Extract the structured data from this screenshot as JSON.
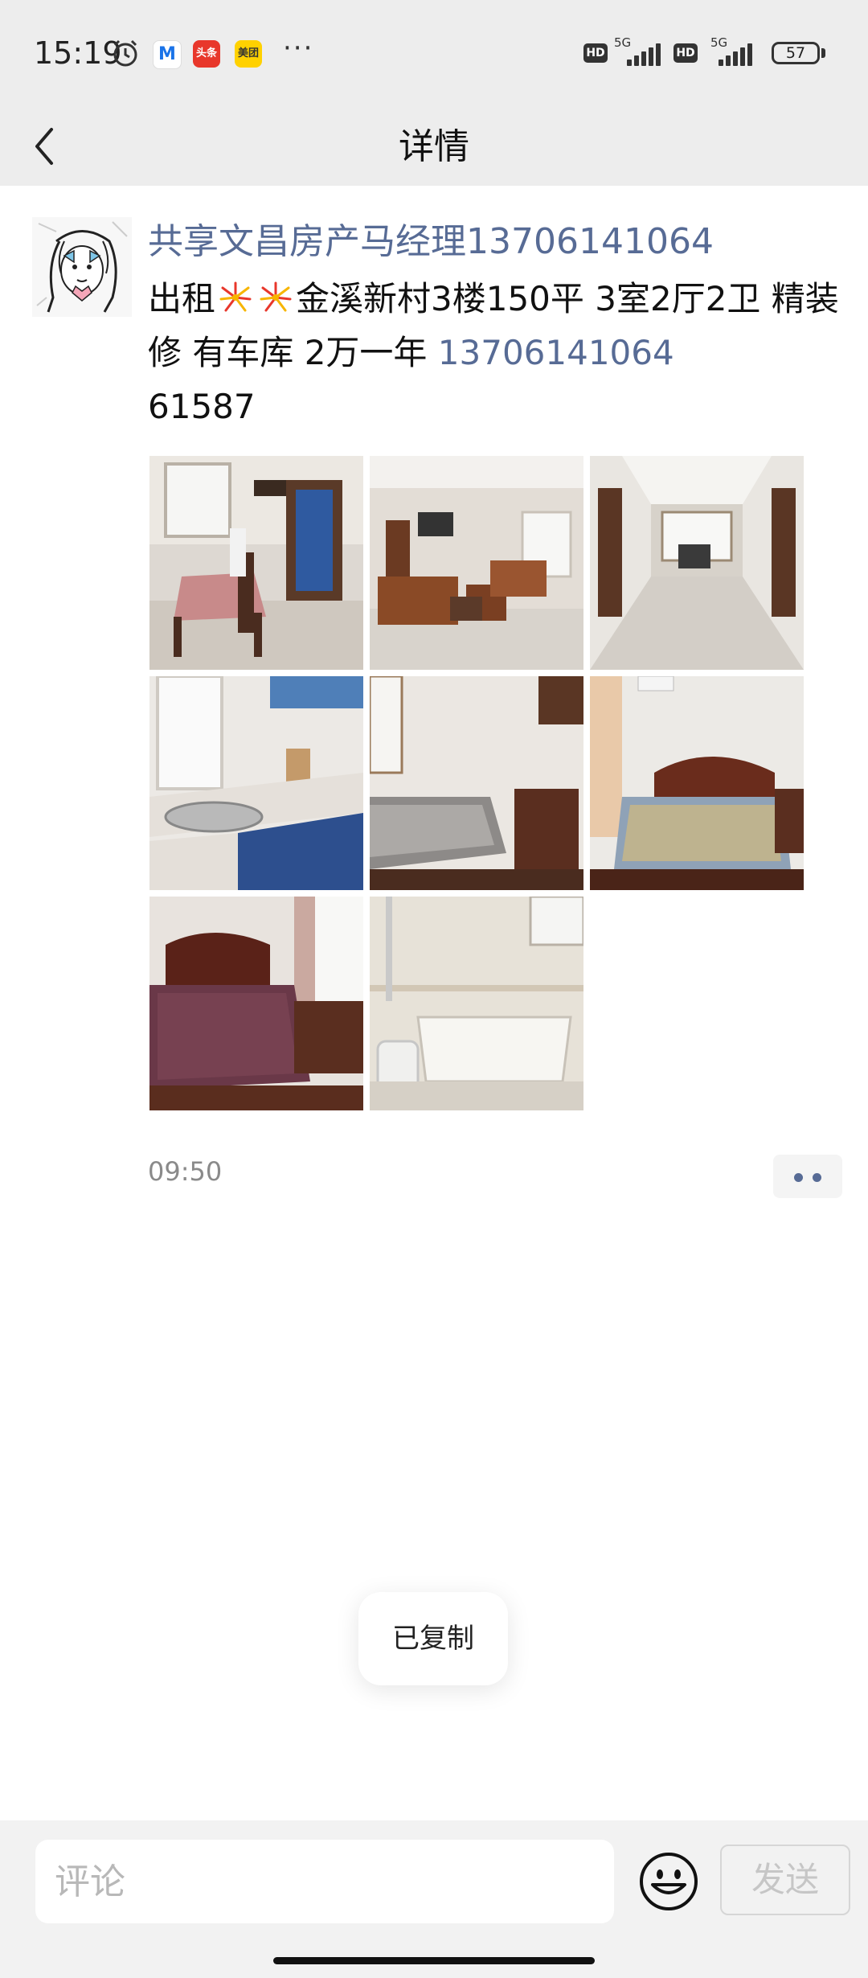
{
  "status_bar": {
    "time": "15:19",
    "apps": [
      {
        "name": "app-icon-m",
        "label": "M",
        "color": "#1a73e8"
      },
      {
        "name": "app-icon-toutiao",
        "label": "头条",
        "color": "#e8372b"
      },
      {
        "name": "app-icon-meituan",
        "label": "美团",
        "color": "#ffd100"
      }
    ],
    "more": "···",
    "hd1": "HD",
    "net1": "5G",
    "hd2": "HD",
    "net2": "5G",
    "battery": "57"
  },
  "header": {
    "title": "详情"
  },
  "post": {
    "author": "共享文昌房产马经理13706141064",
    "text_before": "出租",
    "text_after": "金溪新村3楼150平  3室2厅2卫  精装修  有车库  2万一年 ",
    "phone": "13706141064",
    "text_tail": "61587",
    "time": "09:50",
    "photos": [
      {
        "name": "photo-dining-room"
      },
      {
        "name": "photo-living-room"
      },
      {
        "name": "photo-hall"
      },
      {
        "name": "photo-kitchen"
      },
      {
        "name": "photo-small-bedroom"
      },
      {
        "name": "photo-master-bedroom"
      },
      {
        "name": "photo-second-bedroom"
      },
      {
        "name": "photo-bathroom"
      }
    ]
  },
  "toast": {
    "text": "已复制"
  },
  "comment_bar": {
    "placeholder": "评论",
    "send_label": "发送"
  }
}
